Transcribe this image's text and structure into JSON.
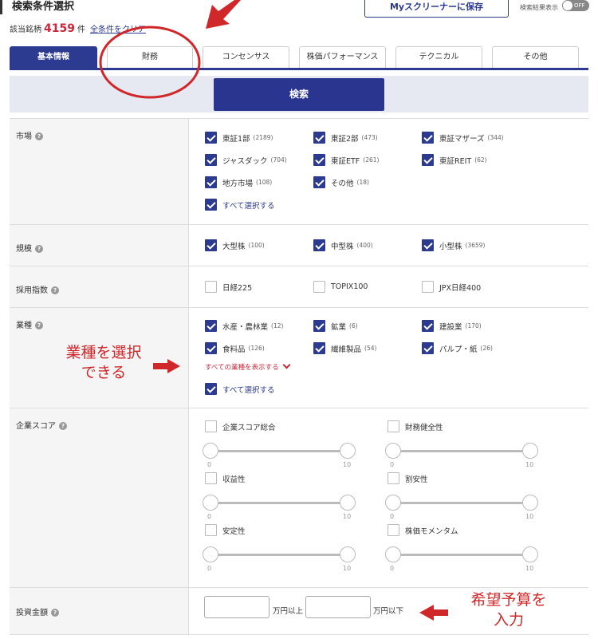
{
  "header": {
    "title": "検索条件選択",
    "count_label": "該当銘柄",
    "count": "4159",
    "count_unit": "件",
    "clear_label": "全条件をクリア",
    "save_label": "Myスクリーナーに保存",
    "toggle_label": "検索結果表示",
    "toggle_state": "OFF"
  },
  "tabs": [
    {
      "label": "基本情報",
      "active": true
    },
    {
      "label": "財務"
    },
    {
      "label": "コンセンサス"
    },
    {
      "label": "株価パフォーマンス"
    },
    {
      "label": "テクニカル"
    },
    {
      "label": "その他"
    }
  ],
  "search_label": "検索",
  "market": {
    "label": "市場",
    "items": [
      {
        "label": "東証1部",
        "count": "(2189)",
        "checked": true
      },
      {
        "label": "東証2部",
        "count": "(473)",
        "checked": true
      },
      {
        "label": "東証マザーズ",
        "count": "(344)",
        "checked": true
      },
      {
        "label": "ジャスダック",
        "count": "(704)",
        "checked": true
      },
      {
        "label": "東証ETF",
        "count": "(261)",
        "checked": true
      },
      {
        "label": "東証REIT",
        "count": "(62)",
        "checked": true
      },
      {
        "label": "地方市場",
        "count": "(108)",
        "checked": true
      },
      {
        "label": "その他",
        "count": "(18)",
        "checked": true
      }
    ],
    "select_all": "すべて選択する"
  },
  "scale": {
    "label": "規模",
    "items": [
      {
        "label": "大型株",
        "count": "(100)",
        "checked": true
      },
      {
        "label": "中型株",
        "count": "(400)",
        "checked": true
      },
      {
        "label": "小型株",
        "count": "(3659)",
        "checked": true
      }
    ]
  },
  "index": {
    "label": "採用指数",
    "items": [
      {
        "label": "日経225",
        "checked": false
      },
      {
        "label": "TOPIX100",
        "checked": false
      },
      {
        "label": "JPX日経400",
        "checked": false
      }
    ]
  },
  "industry": {
    "label": "業種",
    "items": [
      {
        "label": "水産・農林業",
        "count": "(12)",
        "checked": true
      },
      {
        "label": "鉱業",
        "count": "(6)",
        "checked": true
      },
      {
        "label": "建設業",
        "count": "(170)",
        "checked": true
      },
      {
        "label": "食料品",
        "count": "(126)",
        "checked": true
      },
      {
        "label": "繊維製品",
        "count": "(54)",
        "checked": true
      },
      {
        "label": "パルプ・紙",
        "count": "(26)",
        "checked": true
      }
    ],
    "show_all": "すべての業種を表示する",
    "select_all": "すべて選択する"
  },
  "score": {
    "label": "企業スコア",
    "items": [
      {
        "label": "企業スコア総合",
        "checked": false,
        "min": "0",
        "max": "10"
      },
      {
        "label": "財務健全性",
        "checked": false,
        "min": "0",
        "max": "10"
      },
      {
        "label": "収益性",
        "checked": false,
        "min": "0",
        "max": "10"
      },
      {
        "label": "割安性",
        "checked": false,
        "min": "0",
        "max": "10"
      },
      {
        "label": "安定性",
        "checked": false,
        "min": "0",
        "max": "10"
      },
      {
        "label": "株価モメンタム",
        "checked": false,
        "min": "0",
        "max": "10"
      }
    ]
  },
  "investment": {
    "label": "投資金額",
    "from_value": "",
    "from_suffix": "万円以上",
    "to_value": "",
    "to_suffix": "万円以下"
  },
  "annotations": {
    "industry_line1": "業種を選択",
    "industry_line2": "できる",
    "budget_line1": "希望予算を",
    "budget_line2": "入力"
  },
  "colors": {
    "accent": "#2c3a8f",
    "annotation": "#d0282a",
    "count": "#c9283c"
  }
}
